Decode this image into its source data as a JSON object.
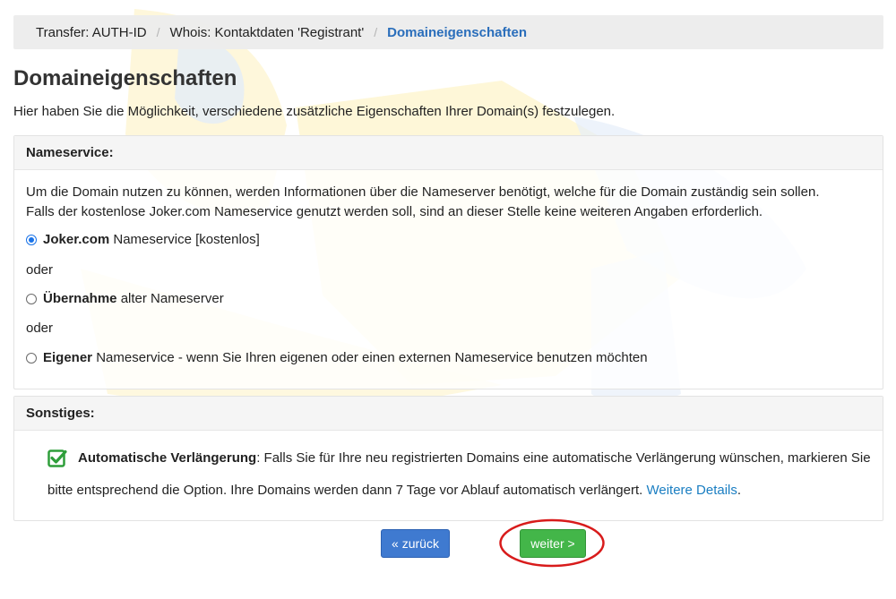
{
  "breadcrumb": {
    "items": [
      "Transfer: AUTH-ID",
      "Whois: Kontaktdaten 'Registrant'",
      "Domaineigenschaften"
    ],
    "separator": "/"
  },
  "page": {
    "title": "Domaineigenschaften",
    "intro": "Hier haben Sie die Möglichkeit, verschiedene zusätzliche Eigenschaften Ihrer Domain(s) festzulegen."
  },
  "nameservice": {
    "heading": "Nameservice:",
    "description_line1": "Um die Domain nutzen zu können, werden Informationen über die Nameserver benötigt, welche für die Domain zuständig sein sollen.",
    "description_line2": "Falls der kostenlose Joker.com Nameservice genutzt werden soll, sind an dieser Stelle keine weiteren Angaben erforderlich.",
    "options": [
      {
        "bold": "Joker.com",
        "text": " Nameservice [kostenlos]",
        "checked": true
      },
      {
        "bold": "Übernahme",
        "text": " alter Nameserver",
        "checked": false
      },
      {
        "bold": "Eigener",
        "text": " Nameservice - wenn Sie Ihren eigenen oder einen externen Nameservice benutzen möchten",
        "checked": false
      }
    ],
    "or_label": "oder"
  },
  "other": {
    "heading": "Sonstiges:",
    "auto_renew": {
      "checked": true,
      "bold": "Automatische Verlängerung",
      "text_line1": ": Falls Sie für Ihre neu registrierten Domains eine automatische Verlängerung wünschen, markieren Sie",
      "text_line2": "bitte entsprechend die Option. Ihre Domains werden dann 7 Tage vor Ablauf automatisch verlängert. ",
      "link": "Weitere Details",
      "trailing": "."
    }
  },
  "buttons": {
    "back": "« zurück",
    "next": "weiter >"
  },
  "colors": {
    "back_button": "#3f7ad0",
    "next_button": "#43b649",
    "link": "#1a7ec2",
    "highlight_ring": "#d81b1b",
    "checkbox": "#2e9e3a"
  }
}
